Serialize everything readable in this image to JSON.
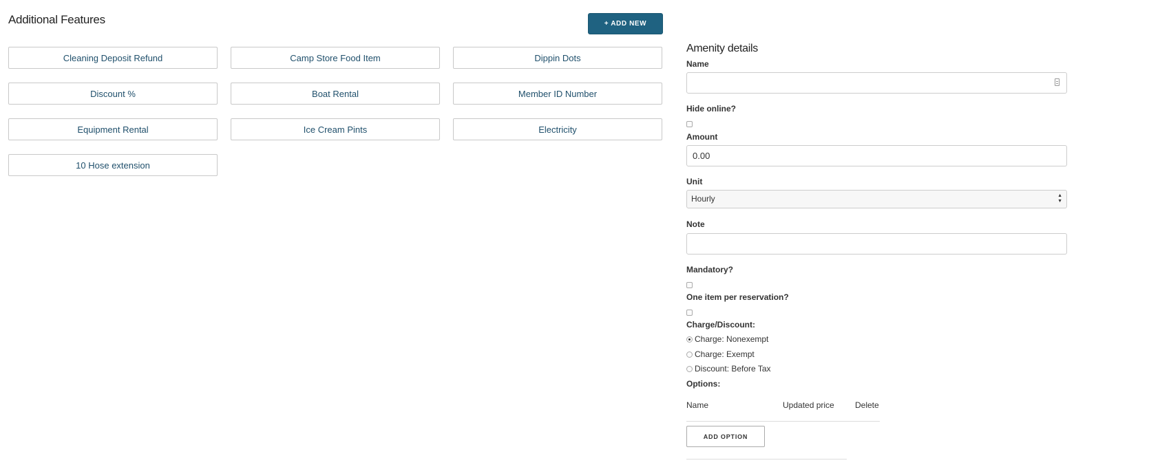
{
  "page": {
    "title": "Additional Features",
    "add_new_label": "+ ADD NEW"
  },
  "features": [
    "Cleaning Deposit Refund",
    "Camp Store Food Item",
    "Dippin Dots",
    "Discount %",
    "Boat Rental",
    "Member ID Number",
    "Equipment Rental",
    "Ice Cream Pints",
    "Electricity",
    "10 Hose extension"
  ],
  "details": {
    "title": "Amenity details",
    "name_label": "Name",
    "name_value": "",
    "hide_online_label": "Hide online?",
    "amount_label": "Amount",
    "amount_value": "0.00",
    "unit_label": "Unit",
    "unit_value": "Hourly",
    "note_label": "Note",
    "note_value": "",
    "mandatory_label": "Mandatory?",
    "one_item_label": "One item per reservation?",
    "charge_discount_label": "Charge/Discount:",
    "radios": [
      {
        "label": "Charge: Nonexempt",
        "checked": true
      },
      {
        "label": "Charge: Exempt",
        "checked": false
      },
      {
        "label": "Discount: Before Tax",
        "checked": false
      }
    ],
    "options_label": "Options:",
    "options_columns": [
      "Name",
      "Updated price",
      "Delete"
    ],
    "add_option_label": "ADD OPTION"
  },
  "colors": {
    "primary": "#1f6281",
    "link_text": "#1f4f6b",
    "border": "#c8c8c8"
  },
  "icons": {
    "name_field_icon": "autofill-icon",
    "unit_select_icon": "select-arrows-icon"
  }
}
